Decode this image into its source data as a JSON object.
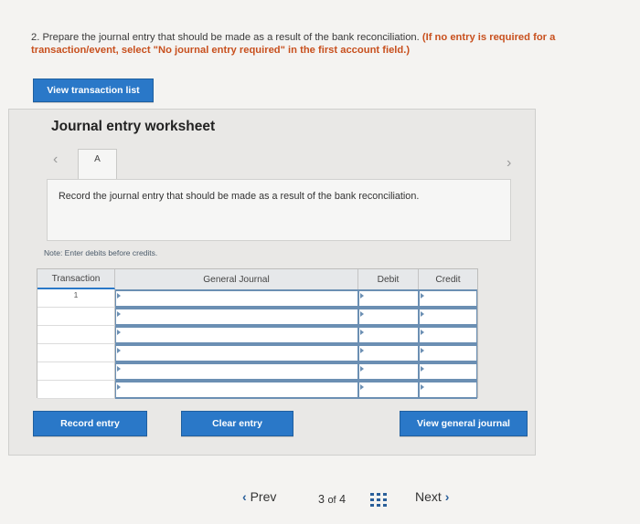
{
  "question": {
    "prefix": "2. Prepare the journal entry that should be made as a result of the bank reconciliation. ",
    "note": "(If no entry is required for a transaction/event, select \"No journal entry required\" in the first account field.)"
  },
  "buttons": {
    "view_transaction_list": "View transaction list",
    "record_entry": "Record entry",
    "clear_entry": "Clear entry",
    "view_general_journal": "View general journal"
  },
  "worksheet": {
    "title": "Journal entry worksheet",
    "tab_label": "A",
    "instruction": "Record the journal entry that should be made as a result of the bank reconciliation.",
    "note": "Note: Enter debits before credits."
  },
  "journal": {
    "headers": {
      "transaction": "Transaction",
      "general_journal": "General Journal",
      "debit": "Debit",
      "credit": "Credit"
    },
    "rows": [
      {
        "transaction": "1",
        "account": "",
        "debit": "",
        "credit": ""
      },
      {
        "transaction": "",
        "account": "",
        "debit": "",
        "credit": ""
      },
      {
        "transaction": "",
        "account": "",
        "debit": "",
        "credit": ""
      },
      {
        "transaction": "",
        "account": "",
        "debit": "",
        "credit": ""
      },
      {
        "transaction": "",
        "account": "",
        "debit": "",
        "credit": ""
      },
      {
        "transaction": "",
        "account": "",
        "debit": "",
        "credit": ""
      }
    ]
  },
  "pager": {
    "prev": "Prev",
    "page_current": "3",
    "page_of": "of",
    "page_total": "4",
    "next": "Next"
  },
  "colors": {
    "accent": "#2a78c8",
    "note": "#c8501e"
  }
}
